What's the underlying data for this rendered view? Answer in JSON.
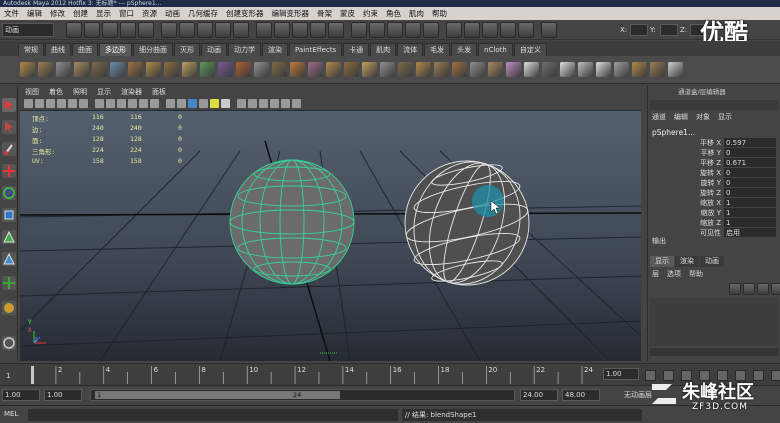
{
  "window": {
    "title": "Autodesk Maya 2012 Hotfix 3: 无标题* --- pSphere1..."
  },
  "menu": [
    "文件",
    "编辑",
    "修改",
    "创建",
    "显示",
    "窗口",
    "资源",
    "动画",
    "几何缓存",
    "创建变形器",
    "编辑变形器",
    "骨架",
    "蒙皮",
    "约束",
    "角色",
    "肌肉",
    "帮助"
  ],
  "status_line": {
    "mode": "动画",
    "field_label": "X:",
    "field_label_2": "Y:",
    "field_label_3": "Z:"
  },
  "shelf_tabs": [
    "常规",
    "曲线",
    "曲面",
    "多边形",
    "细分曲面",
    "灭形",
    "动画",
    "动力学",
    "渲染",
    "PaintEffects",
    "卡通",
    "肌肉",
    "流体",
    "毛发",
    "头发",
    "nCloth",
    "自定义"
  ],
  "active_shelf_tab": "多边形",
  "panel_menu": [
    "视图",
    "着色",
    "照明",
    "显示",
    "渲染器",
    "面板"
  ],
  "hud": {
    "rows": [
      {
        "label": "顶点:",
        "v1": "116",
        "v2": "116",
        "v3": "0"
      },
      {
        "label": "边:",
        "v1": "240",
        "v2": "240",
        "v3": "0"
      },
      {
        "label": "面:",
        "v1": "128",
        "v2": "128",
        "v3": "0"
      },
      {
        "label": "三角形:",
        "v1": "224",
        "v2": "224",
        "v3": "0"
      },
      {
        "label": "UV:",
        "v1": "158",
        "v2": "158",
        "v3": "0"
      }
    ]
  },
  "axis_labels": {
    "x": "X",
    "y": "Y",
    "z": "Z"
  },
  "channel_box": {
    "title": "通道盒/层编辑器",
    "menu": [
      "通道",
      "编辑",
      "对象",
      "显示"
    ],
    "object_name": "pSphere1...",
    "attributes": [
      {
        "label": "平移 X",
        "value": "0.597"
      },
      {
        "label": "平移 Y",
        "value": "0"
      },
      {
        "label": "平移 Z",
        "value": "0.671"
      },
      {
        "label": "旋转 X",
        "value": "0"
      },
      {
        "label": "旋转 Y",
        "value": "0"
      },
      {
        "label": "旋转 Z",
        "value": "0"
      },
      {
        "label": "缩放 X",
        "value": "1"
      },
      {
        "label": "缩放 Y",
        "value": "1"
      },
      {
        "label": "缩放 Z",
        "value": "1"
      },
      {
        "label": "可见性",
        "value": "启用"
      }
    ],
    "inputs_label": "输出",
    "layer_tabs": [
      "显示",
      "渲染",
      "动画"
    ],
    "layer_menu": [
      "层",
      "选项",
      "帮助"
    ]
  },
  "timeline": {
    "ticks": [
      "2",
      "4",
      "6",
      "8",
      "10",
      "12",
      "14",
      "16",
      "18",
      "20",
      "22",
      "24"
    ],
    "left_frame": "1",
    "current_frame": "1.00"
  },
  "range_slider": {
    "start": "1.00",
    "start2": "1.00",
    "slider_start": "1",
    "slider_end": "24",
    "end": "24.00",
    "end2": "48.00",
    "anim_layer": "无动画层"
  },
  "command_line": {
    "label": "MEL",
    "result": "// 结果: blendShape1"
  },
  "watermark": {
    "top": "优酷",
    "brand": "朱峰社区",
    "site": "ZF3D.COM"
  }
}
